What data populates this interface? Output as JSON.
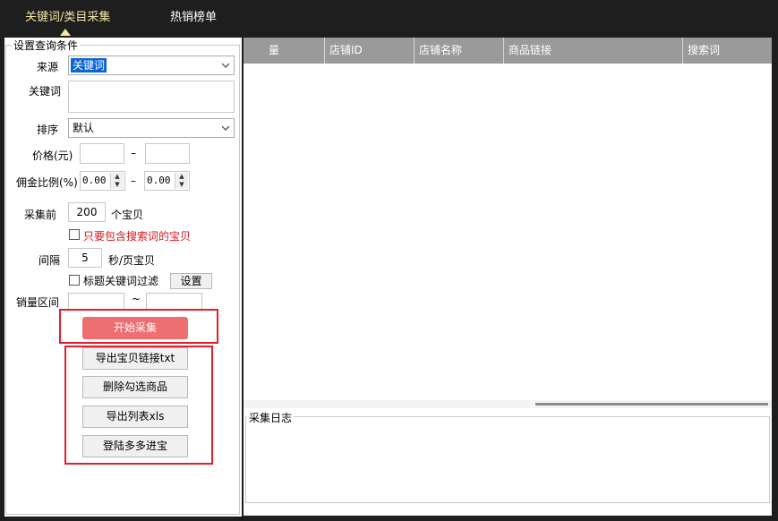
{
  "tabs": [
    {
      "label": "关键词/类目采集",
      "active": true
    },
    {
      "label": "热销榜单",
      "active": false
    }
  ],
  "query": {
    "group_title": "设置查询条件",
    "source_label": "来源",
    "source_value": "关键词",
    "keyword_label": "关键词",
    "keyword_value": "",
    "sort_label": "排序",
    "sort_value": "默认",
    "price_label": "价格(元)",
    "price_min": "",
    "price_max": "",
    "range_sep": "–",
    "commission_label": "佣金比例(%)",
    "commission_min": "0.00",
    "commission_max": "0.00",
    "collect_label": "采集前",
    "collect_value": "200",
    "collect_unit": "个宝贝",
    "only_keyword_label": "只要包含搜索词的宝贝",
    "only_keyword_checked": false,
    "interval_label": "间隔",
    "interval_value": "5",
    "interval_unit": "秒/页宝贝",
    "title_filter_label": "标题关键词过滤",
    "title_filter_checked": false,
    "settings_button": "设置",
    "sales_label": "销量区间",
    "sales_min": "",
    "sales_sep": "~",
    "sales_max": ""
  },
  "actions": {
    "start": "开始采集",
    "export_txt": "导出宝贝链接txt",
    "delete_checked": "删除勾选商品",
    "export_xls": "导出列表xls",
    "login": "登陆多多进宝"
  },
  "table": {
    "columns": [
      "量",
      "店铺ID",
      "店铺名称",
      "商品链接",
      "搜索词"
    ]
  },
  "log": {
    "title": "采集日志"
  },
  "colors": {
    "start_button": "#ee6f72",
    "highlight_box": "#e2202a",
    "header": "#9a9a9a",
    "active_tab": "#f3e6a3"
  }
}
